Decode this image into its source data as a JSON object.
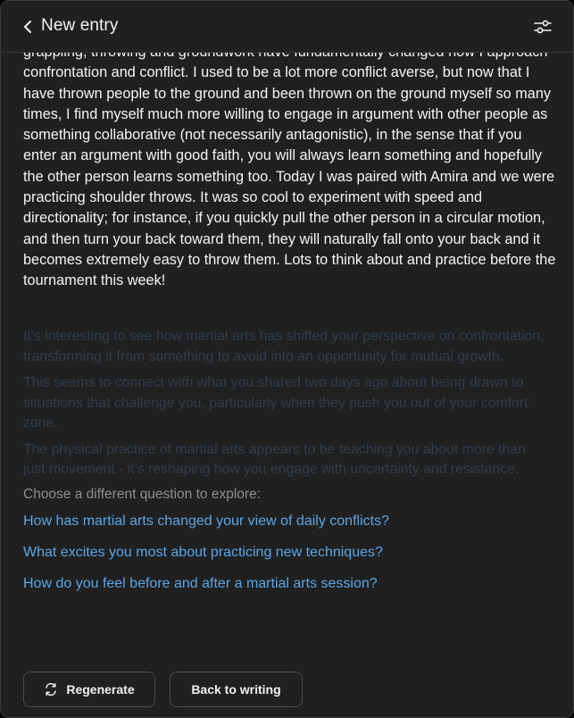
{
  "header": {
    "title": "New entry",
    "back_icon": "chevron-left-icon",
    "settings_icon": "sliders-icon"
  },
  "entry": {
    "text": "grappling, throwing and groundwork have fundamentally changed how I approach confrontation and conflict. I used to be a lot more conflict averse, but now that I have thrown people to the ground and been thrown on the ground myself so many times, I find myself much more willing to engage in argument with other people as something collaborative (not necessarily antagonistic), in the sense that if you enter an argument with good faith, you will always learn something and hopefully the other person learns something too. Today I was paired with Amira and we were practicing shoulder throws. It was so cool to experiment with speed and directionality; for instance, if you quickly pull the other person in a circular motion, and then turn your back toward them, they will naturally fall onto your back and it becomes extremely easy to throw them. Lots to think about and practice before the tournament this week!"
  },
  "reflections": [
    "It's interesting to see how martial arts has shifted your perspective on confrontation, transforming it from something to avoid into an opportunity for mutual growth.",
    "This seems to connect with what you shared two days ago about being drawn to situations that challenge you, particularly when they push you out of your comfort zone.",
    "The physical practice of martial arts appears to be teaching you about more than just movement - it's reshaping how you engage with uncertainty and resistance."
  ],
  "questions": {
    "label": "Choose a different question to explore:",
    "items": [
      "How has martial arts changed your view of daily conflicts?",
      "What excites you most about practicing new techniques?",
      "How do you feel before and after a martial arts session?"
    ]
  },
  "actions": {
    "regenerate_label": "Regenerate",
    "regenerate_icon": "refresh-icon",
    "back_label": "Back to writing"
  },
  "colors": {
    "background": "#202020",
    "text": "#f4f4f4",
    "reflection_text": "#2f3d4c",
    "link": "#5aa6e6",
    "muted": "#8e8e8e"
  }
}
